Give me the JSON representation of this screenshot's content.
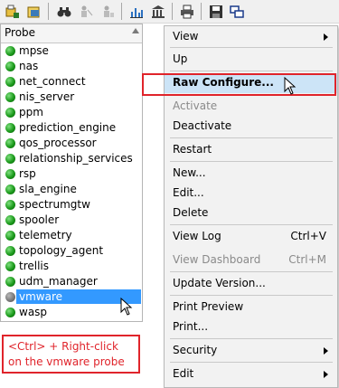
{
  "toolbar": {
    "buttons": [
      {
        "name": "probe-config-icon"
      },
      {
        "name": "folder-config-icon"
      },
      {
        "name": "binoculars-icon"
      },
      {
        "name": "person-network-icon"
      },
      {
        "name": "person-config-icon"
      },
      {
        "name": "bar-chart-icon"
      },
      {
        "name": "building-icon"
      },
      {
        "name": "printer-icon"
      },
      {
        "name": "save-icon"
      },
      {
        "name": "windows-icon"
      }
    ]
  },
  "probe_panel": {
    "header": "Probe",
    "items": [
      {
        "label": "mpse"
      },
      {
        "label": "nas"
      },
      {
        "label": "net_connect"
      },
      {
        "label": "nis_server"
      },
      {
        "label": "ppm"
      },
      {
        "label": "prediction_engine"
      },
      {
        "label": "qos_processor"
      },
      {
        "label": "relationship_services"
      },
      {
        "label": "rsp"
      },
      {
        "label": "sla_engine"
      },
      {
        "label": "spectrumgtw"
      },
      {
        "label": "spooler"
      },
      {
        "label": "telemetry"
      },
      {
        "label": "topology_agent"
      },
      {
        "label": "trellis"
      },
      {
        "label": "udm_manager"
      },
      {
        "label": "vmware",
        "selected": true
      },
      {
        "label": "wasp"
      }
    ]
  },
  "callout": {
    "text": "<Ctrl> + Right-click on the vmware probe"
  },
  "context_menu": {
    "items": [
      {
        "label": "View",
        "submenu": true
      },
      {
        "label": "Up"
      },
      {
        "label": "Raw Configure...",
        "highlighted": true
      },
      {
        "label": "Activate",
        "disabled": true
      },
      {
        "label": "Deactivate"
      },
      {
        "label": "Restart"
      },
      {
        "label": "New..."
      },
      {
        "label": "Edit..."
      },
      {
        "label": "Delete"
      },
      {
        "label": "View Log",
        "shortcut": "Ctrl+V"
      },
      {
        "label": "View Dashboard",
        "shortcut": "Ctrl+M",
        "disabled": true
      },
      {
        "label": "Update Version..."
      },
      {
        "label": "Print Preview"
      },
      {
        "label": "Print..."
      },
      {
        "label": "Security",
        "submenu": true
      },
      {
        "label": "Edit",
        "submenu": true
      }
    ]
  },
  "colors": {
    "highlight_border": "#e0242b",
    "selection": "#3399ff",
    "menu_hover": "#cce4f7",
    "status_ok": "#1b9a1b"
  }
}
